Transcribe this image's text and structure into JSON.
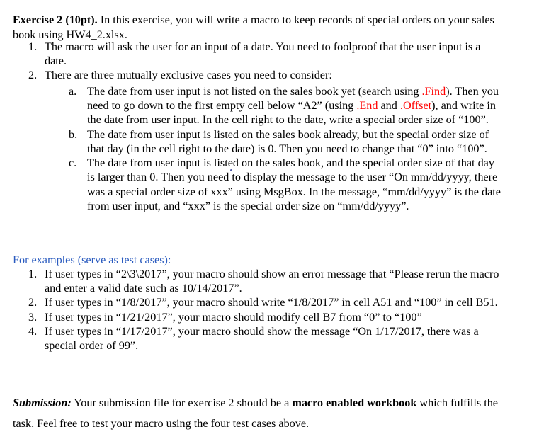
{
  "document": {
    "intro": {
      "heading": "Exercise 2 (10pt).",
      "body": " In this exercise, you will write a macro to keep records of special orders on your sales book using HW4_2.xlsx."
    },
    "main_list": [
      {
        "marker": "1.",
        "text": "The macro will ask the user for an input of a date. You need to foolproof that the user input is a date."
      },
      {
        "marker": "2.",
        "text": "There are three mutually exclusive cases you need to consider:",
        "sub_list": [
          {
            "marker": "a.",
            "part1": "The date from user input is not listed on the sales book yet (search using ",
            "code1": ".Find",
            "part2": "). Then you need to go down to the first empty cell below “A2” (using ",
            "code2": ".End",
            "part3": " and ",
            "code3": ".Offset",
            "part4": "), and write in the date from user input. In the cell right to the date, write a special order size of “100”."
          },
          {
            "marker": "b.",
            "text": "The date from user input is listed on the sales book already, but the special order size of that day (in the cell right to the date) is 0. Then you need to change that “0” into “100”."
          },
          {
            "marker": "c.",
            "text": "The date from user input is listed on the sales book, and the special order size of that day is larger than 0. Then you need to display the message to the user “On mm/dd/yyyy, there was a special order size of xxx” using MsgBox. In the message, “mm/dd/yyyy” is the date from user input, and “xxx” is the special order size on “mm/dd/yyyy”."
          }
        ]
      }
    ],
    "examples_heading": "For examples (serve as test cases):",
    "examples_list": [
      {
        "marker": "1.",
        "text": "If user types in “2\\3\\2017”, your macro should show an error message that “Please rerun the macro and enter a valid date such as 10/14/2017”."
      },
      {
        "marker": "2.",
        "text": "If user types in “1/8/2017”, your macro should write “1/8/2017” in cell A51 and “100” in cell B51."
      },
      {
        "marker": "3.",
        "text": "If user types in “1/21/2017”, your macro should modify cell B7 from “0” to “100”"
      },
      {
        "marker": "4.",
        "text": "If user types in “1/17/2017”, your macro should show the message “On 1/17/2017, there was a special order of 99”."
      }
    ],
    "submission": {
      "label": "Submission:",
      "part1": " Your submission file for exercise 2 should be a ",
      "emphasis": "macro enabled workbook",
      "part2": " which fulfills the task. Feel free to test your macro using the four test cases above."
    },
    "colors": {
      "code_accent": "#FF0000",
      "heading_accent": "#2A5BBF",
      "body_text": "#000000",
      "page_background": "#FFFFFF"
    }
  }
}
